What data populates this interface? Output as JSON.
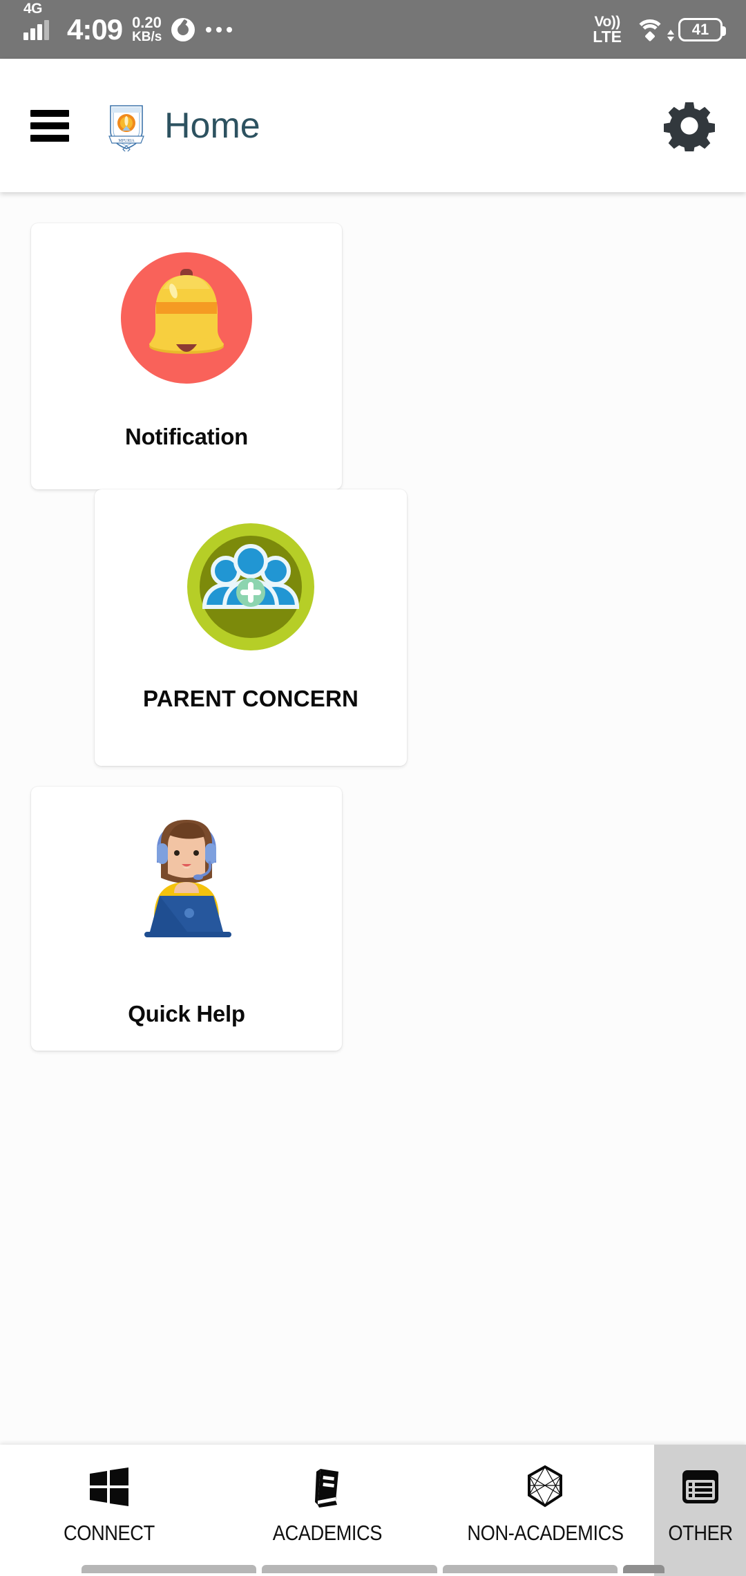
{
  "status_bar": {
    "network_type": "4G",
    "time": "4:09",
    "net_speed_value": "0.20",
    "net_speed_unit": "KB/s",
    "chrome_icon": "chrome-icon",
    "overflow_icon": "more-dots-icon",
    "volte_line1": "Vo))",
    "volte_line2": "LTE",
    "wifi_icon": "wifi-icon",
    "battery_level": "41"
  },
  "app_bar": {
    "menu_icon": "hamburger-menu-icon",
    "logo_icon": "school-crest-logo",
    "title": "Home",
    "settings_icon": "gear-icon"
  },
  "cards": [
    {
      "id": "notification",
      "label": "Notification",
      "icon": "bell-icon",
      "icon_bg": "#F9625A",
      "icon_fg": "#F7CF3F"
    },
    {
      "id": "parent-concern",
      "label": "PARENT CONCERN",
      "icon": "people-group-add-icon",
      "icon_bg": "#7C8A0B",
      "icon_ring": "#B6CE27",
      "icon_fg": "#2196D3"
    },
    {
      "id": "quick-help",
      "label": "Quick Help",
      "icon": "support-agent-icon",
      "icon_fg": "#F4C20D",
      "icon_accent": "#1F4E91"
    }
  ],
  "bottom_nav": {
    "items": [
      {
        "id": "connect",
        "label": "CONNECT",
        "icon": "windows-grid-icon",
        "active": false
      },
      {
        "id": "academics",
        "label": "ACADEMICS",
        "icon": "book-icon",
        "active": false
      },
      {
        "id": "non-academics",
        "label": "NON-ACADEMICS",
        "icon": "hexagon-network-icon",
        "active": false
      },
      {
        "id": "other",
        "label": "OTHER",
        "icon": "list-table-icon",
        "active": true
      }
    ]
  },
  "colors": {
    "status_bar_bg": "#767676",
    "app_bar_bg": "#ffffff",
    "title_color": "#2d5260",
    "page_bg": "#fcfcfc",
    "active_tab_bg": "#d0d0d0"
  }
}
